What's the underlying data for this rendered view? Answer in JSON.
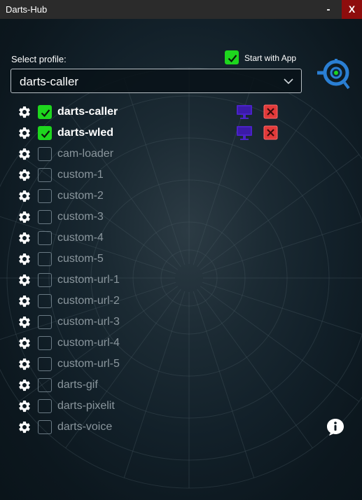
{
  "window": {
    "title": "Darts-Hub",
    "minimize_label": "-",
    "close_label": "X"
  },
  "profile": {
    "select_label": "Select profile:",
    "selected": "darts-caller",
    "start_with_app_label": "Start with App",
    "start_with_app_checked": true
  },
  "apps": [
    {
      "name": "darts-caller",
      "enabled": true
    },
    {
      "name": "darts-wled",
      "enabled": true
    },
    {
      "name": "cam-loader",
      "enabled": false
    },
    {
      "name": "custom-1",
      "enabled": false
    },
    {
      "name": "custom-2",
      "enabled": false
    },
    {
      "name": "custom-3",
      "enabled": false
    },
    {
      "name": "custom-4",
      "enabled": false
    },
    {
      "name": "custom-5",
      "enabled": false
    },
    {
      "name": "custom-url-1",
      "enabled": false
    },
    {
      "name": "custom-url-2",
      "enabled": false
    },
    {
      "name": "custom-url-3",
      "enabled": false
    },
    {
      "name": "custom-url-4",
      "enabled": false
    },
    {
      "name": "custom-url-5",
      "enabled": false
    },
    {
      "name": "darts-gif",
      "enabled": false
    },
    {
      "name": "darts-pixelit",
      "enabled": false
    },
    {
      "name": "darts-voice",
      "enabled": false
    }
  ],
  "icons": {
    "settings": "gear-icon",
    "monitor": "monitor-icon",
    "close": "close-icon",
    "logo": "dartboard-logo-icon",
    "info": "info-icon",
    "dropdown": "chevron-down-icon"
  },
  "colors": {
    "check_on": "#1ed61e",
    "monitor": "#4a22c8",
    "close_box": "#e23a3a",
    "logo": "#2a7fd4",
    "titlebar_close": "#8e0d0d"
  }
}
